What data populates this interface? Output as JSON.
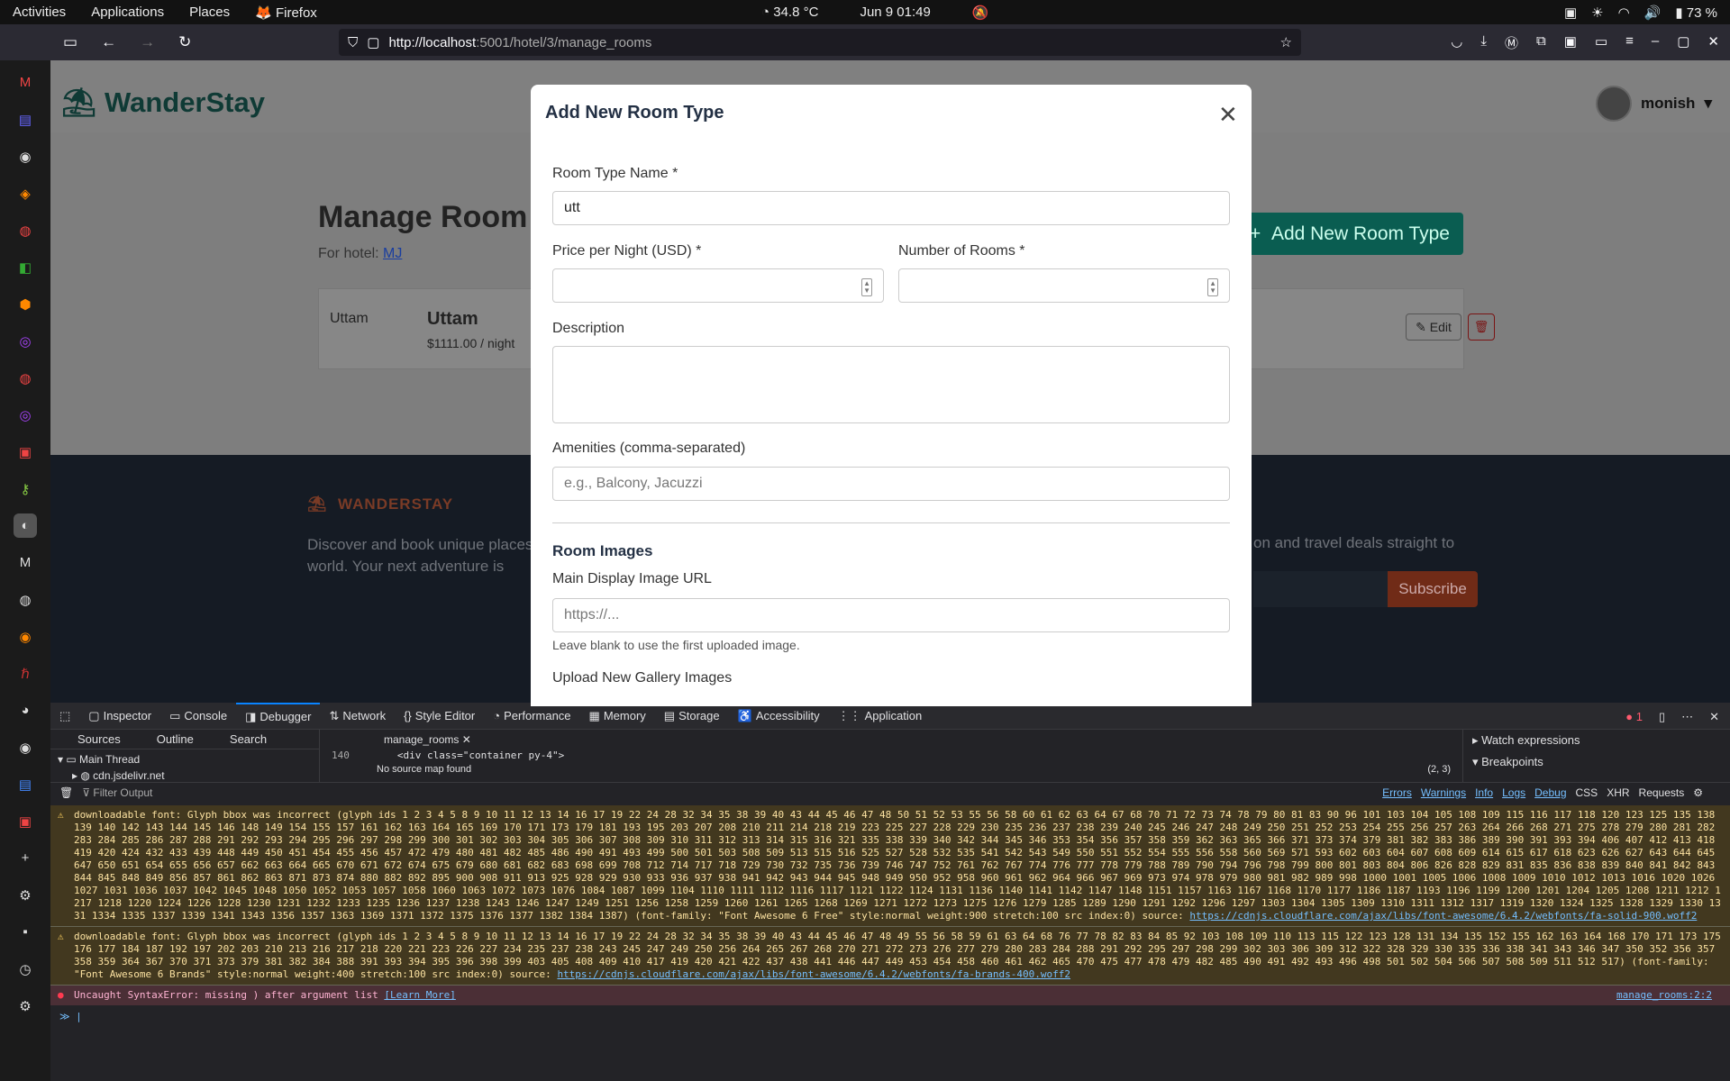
{
  "topbar": {
    "activities": "Activities",
    "applications": "Applications",
    "places": "Places",
    "firefox": "Firefox",
    "temp": "34.8 °C",
    "date": "Jun 9  01:49",
    "battery": "73 %"
  },
  "browser": {
    "url_host": "http://localhost",
    "url_path": ":5001/hotel/3/manage_rooms"
  },
  "page": {
    "logo": "WanderStay",
    "user": "monish",
    "title": "Manage Room",
    "for_hotel_label": "For hotel:",
    "hotel": "MJ",
    "add_button": "Add New Room Type",
    "room": {
      "code": "Uttam",
      "name": "Uttam",
      "price": "$1111.00 / night",
      "edit": "Edit"
    },
    "footer": {
      "brand": "WANDERSTAY",
      "text": "Discover and book unique places the world. Your next adventure is",
      "right": "on and travel deals straight to",
      "subscribe": "Subscribe"
    }
  },
  "modal": {
    "title": "Add New Room Type",
    "name_label": "Room Type Name *",
    "name_value": "utt",
    "price_label": "Price per Night (USD) *",
    "rooms_label": "Number of Rooms *",
    "desc_label": "Description",
    "amen_label": "Amenities (comma-separated)",
    "amen_ph": "e.g., Balcony, Jacuzzi",
    "images_section": "Room Images",
    "main_img_label": "Main Display Image URL",
    "main_img_ph": "https://...",
    "main_img_hint": "Leave blank to use the first uploaded image.",
    "gallery_label": "Upload New Gallery Images"
  },
  "devtools": {
    "tabs": [
      "Inspector",
      "Console",
      "Debugger",
      "Network",
      "Style Editor",
      "Performance",
      "Memory",
      "Storage",
      "Accessibility",
      "Application"
    ],
    "error_count": "1",
    "sources_tabs": [
      "Sources",
      "Outline",
      "Search"
    ],
    "main_thread": "Main Thread",
    "cdn": "cdn.jsdelivr.net",
    "file_tab": "manage_rooms",
    "line_no": "140",
    "line_code": "<div class=\"container py-4\">",
    "no_map": "No source map found",
    "pos": "(2, 3)",
    "watch": "Watch expressions",
    "breakpoints": "Breakpoints",
    "filter": "Filter Output",
    "filters": [
      "Errors",
      "Warnings",
      "Info",
      "Logs",
      "Debug",
      "CSS",
      "XHR",
      "Requests"
    ],
    "warn1": "downloadable font: Glyph bbox was incorrect (glyph ids 1 2 3 4 5 8 9 10 11 12 13 14 16 17 19 22 24 28 32 34 35 38 39 40 43 44 45 46 47 48 50 51 52 53 55 56 58 60 61 62 63 64 67 68 70 71 72 73 74 78 79 80 81 83 90 96 101 103 104 105 108 109 115 116 117 118 120 123 125 135 138 139 140 142 143 144 145 146 148 149 154 155 157 161 162 163 164 165 169 170 171 173 179 181 193 195 203 207 208 210 211 214 218 219 223 225 227 228 229 230 235 236 237 238 239 240 245 246 247 248 249 250 251 252 253 254 255 256 257 263 264 266 268 271 275 278 279 280 281 282 283 284 285 286 287 288 291 292 293 294 295 296 297 298 299 300 301 302 303 304 305 306 307 308 309 310 311 312 313 314 315 316 321 335 338 339 340 342 344 345 346 353 354 356 357 358 359 362 363 365 366 371 373 374 379 381 382 383 386 389 390 391 393 394 406 407 412 413 418 419 420 424 432 433 439 448 449 450 451 454 455 456 457 472 479 480 481 482 485 486 490 491 493 499 500 501 503 508 509 513 515 516 525 527 528 532 535 541 542 543 549 550 551 552 554 555 556 558 560 569 571 593 602 603 604 607 608 609 614 615 617 618 623 626 627 643 644 645 647 650 651 654 655 656 657 662 663 664 665 670 671 672 674 675 679 680 681 682 683 698 699 708 712 714 717 718 729 730 732 735 736 739 746 747 752 761 762 767 774 776 777 778 779 788 789 790 794 796 798 799 800 801 803 804 806 826 828 829 831 835 836 838 839 840 841 842 843 844 845 848 849 856 857 861 862 863 871 873 874 880 882 892 895 900 908 911 913 925 928 929 930 933 936 937 938 941 942 943 944 945 948 949 950 952 958 960 961 962 964 966 967 969 973 974 978 979 980 981 982 989 998 1000 1001 1005 1006 1008 1009 1010 1012 1013 1016 1020 1026 1027 1031 1036 1037 1042 1045 1048 1050 1052 1053 1057 1058 1060 1063 1072 1073 1076 1084 1087 1099 1104 1110 1111 1112 1116 1117 1121 1122 1124 1131 1136 1140 1141 1142 1147 1148 1151 1157 1163 1167 1168 1170 1177 1186 1187 1193 1196 1199 1200 1201 1204 1205 1208 1211 1212 1217 1218 1220 1224 1226 1228 1230 1231 1232 1233 1235 1236 1237 1238 1243 1246 1247 1249 1251 1256 1258 1259 1260 1261 1265 1268 1269 1271 1272 1273 1275 1276 1279 1285 1289 1290 1291 1292 1296 1297 1303 1304 1305 1309 1310 1311 1312 1317 1319 1320 1324 1325 1328 1329 1330 1331 1334 1335 1337 1339 1341 1343 1356 1357 1363 1369 1371 1372 1375 1376 1377 1382 1384 1387) (font-family: \"Font Awesome 6 Free\" style:normal weight:900 stretch:100 src index:0) source:",
    "warn1_src": "https://cdnjs.cloudflare.com/ajax/libs/font-awesome/6.4.2/webfonts/fa-solid-900.woff2",
    "warn2": "downloadable font: Glyph bbox was incorrect (glyph ids 1 2 3 4 5 8 9 10 11 12 13 14 16 17 19 22 24 28 32 34 35 38 39 40 43 44 45 46 47 48 49 55 56 58 59 61 63 64 68 76 77 78 82 83 84 85 92 103 108 109 110 113 115 122 123 128 131 134 135 152 155 162 163 164 168 170 171 173 175 176 177 184 187 192 197 202 203 210 213 216 217 218 220 221 223 226 227 234 235 237 238 243 245 247 249 250 256 264 265 267 268 270 271 272 273 276 277 279 280 283 284 288 291 292 295 297 298 299 302 303 306 309 312 322 328 329 330 335 336 338 341 343 346 347 350 352 356 357 358 359 364 367 370 371 373 379 381 382 384 388 391 393 394 395 396 398 399 403 405 408 409 410 417 419 420 421 422 437 438 441 446 447 449 453 454 458 460 461 462 465 470 475 477 478 479 482 485 490 491 492 493 496 498 501 502 504 506 507 508 509 511 512 517) (font-family: \"Font Awesome 6 Brands\" style:normal weight:400 stretch:100 src index:0) source:",
    "warn2_src": "https://cdnjs.cloudflare.com/ajax/libs/font-awesome/6.4.2/webfonts/fa-brands-400.woff2",
    "error": "Uncaught SyntaxError: missing ) after argument list",
    "learn": "[Learn More]",
    "err_src": "manage_rooms:2:2"
  }
}
